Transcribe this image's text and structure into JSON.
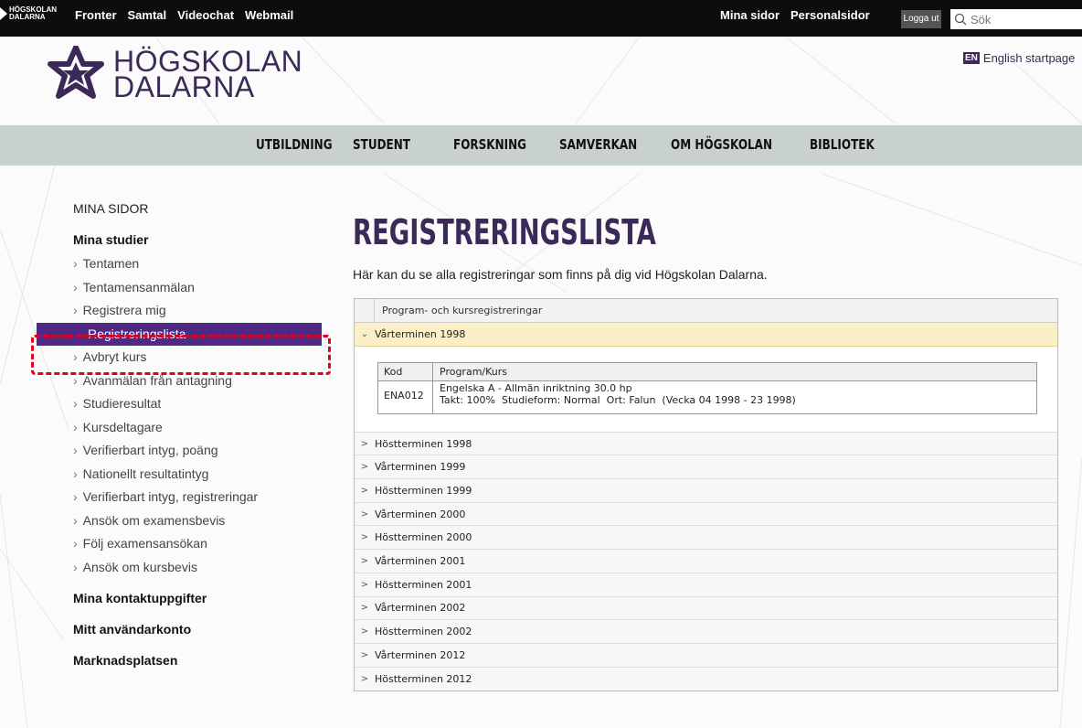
{
  "topbar": {
    "mini_logo_line1": "HÖGSKOLAN",
    "mini_logo_line2": "DALARNA",
    "left_links": [
      "Fronter",
      "Samtal",
      "Videochat",
      "Webmail"
    ],
    "right_links": [
      "Mina sidor",
      "Personalsidor"
    ],
    "logout_label": "Logga ut",
    "search_placeholder": "Sök"
  },
  "header": {
    "logo_line1": "HÖGSKOLAN",
    "logo_line2": "DALARNA",
    "lang_badge": "EN",
    "lang_link": "English startpage",
    "brand_color": "#3b2a58"
  },
  "mainnav": [
    "UTBILDNING",
    "STUDENT",
    "FORSKNING",
    "SAMVERKAN",
    "OM HÖGSKOLAN",
    "BIBLIOTEK"
  ],
  "sidebar": {
    "heading": "MINA SIDOR",
    "section1": "Mina studier",
    "items": [
      "Tentamen",
      "Tentamensanmälan",
      "Registrera mig",
      "Registreringslista",
      "Avbryt kurs",
      "Avanmälan från antagning",
      "Studieresultat",
      "Kursdeltagare",
      "Verifierbart intyg, poäng",
      "Nationellt resultatintyg",
      "Verifierbart intyg, registreringar",
      "Ansök om examensbevis",
      "Följ examensansökan",
      "Ansök om kursbevis"
    ],
    "active_index": 3,
    "section2": "Mina kontaktuppgifter",
    "section3": "Mitt användarkonto",
    "section4": "Marknadsplatsen"
  },
  "content": {
    "title": "REGISTRERINGSLISTA",
    "intro": "Här kan du se alla registreringar som finns på dig vid Högskolan Dalarna.",
    "table_header": "Program- och kursregistreringar",
    "open_term": "Vårterminen 1998",
    "course_table": {
      "col1": "Kod",
      "col2": "Program/Kurs",
      "code": "ENA012",
      "line1": "Engelska A - Allmän inriktning 30.0 hp",
      "line2": "Takt: 100%  Studieform: Normal  Ort: Falun  (Vecka 04 1998 - 23 1998)"
    },
    "terms": [
      "Höstterminen 1998",
      "Vårterminen 1999",
      "Höstterminen 1999",
      "Vårterminen 2000",
      "Höstterminen 2000",
      "Vårterminen 2001",
      "Höstterminen 2001",
      "Vårterminen 2002",
      "Höstterminen 2002",
      "Vårterminen 2012",
      "Höstterminen 2012"
    ]
  }
}
